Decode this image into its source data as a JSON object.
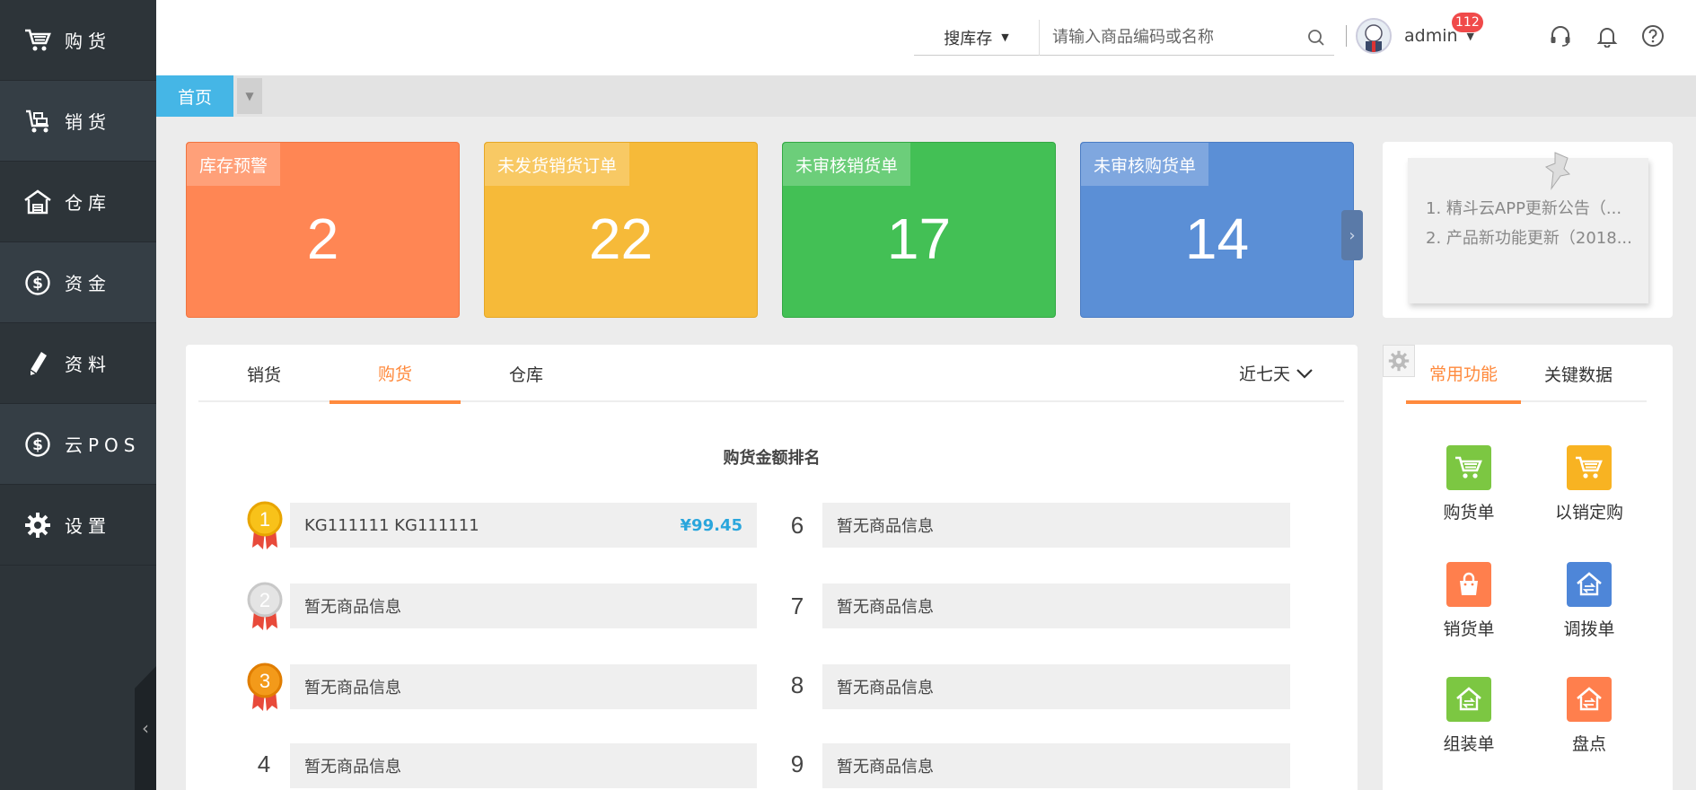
{
  "sidebar": {
    "items": [
      {
        "label": "购货",
        "icon": "cart-icon"
      },
      {
        "label": "销货",
        "icon": "trolley-icon"
      },
      {
        "label": "仓库",
        "icon": "warehouse-icon"
      },
      {
        "label": "资金",
        "icon": "dollar-icon"
      },
      {
        "label": "资料",
        "icon": "pencil-icon"
      },
      {
        "label": "云POS",
        "icon": "dollar-icon"
      },
      {
        "label": "设置",
        "icon": "gear-icon"
      }
    ],
    "collapse_glyph": "‹"
  },
  "header": {
    "search_type": "搜库存",
    "search_placeholder": "请输入商品编码或名称",
    "username": "admin",
    "notification_count": "112"
  },
  "tabs": {
    "home": "首页"
  },
  "stats": [
    {
      "label": "库存预警",
      "value": "2",
      "color": "#ff8654"
    },
    {
      "label": "未发货销货订单",
      "value": "22",
      "color": "#f6ba39"
    },
    {
      "label": "未审核销货单",
      "value": "17",
      "color": "#43c055"
    },
    {
      "label": "未审核购货单",
      "value": "14",
      "color": "#5b8fd6"
    }
  ],
  "notices": [
    "1. 精斗云APP更新公告（...",
    "2. 产品新功能更新（2018..."
  ],
  "main": {
    "tabs": [
      "销货",
      "购货",
      "仓库"
    ],
    "active_tab": "购货",
    "period": "近七天",
    "ranking_title": "购货金额排名",
    "ranking": [
      {
        "rank": "1",
        "name": "KG111111 KG111111",
        "amount": "¥99.45"
      },
      {
        "rank": "2",
        "name": "暂无商品信息",
        "amount": ""
      },
      {
        "rank": "3",
        "name": "暂无商品信息",
        "amount": ""
      },
      {
        "rank": "4",
        "name": "暂无商品信息",
        "amount": ""
      },
      {
        "rank": "6",
        "name": "暂无商品信息",
        "amount": ""
      },
      {
        "rank": "7",
        "name": "暂无商品信息",
        "amount": ""
      },
      {
        "rank": "8",
        "name": "暂无商品信息",
        "amount": ""
      },
      {
        "rank": "9",
        "name": "暂无商品信息",
        "amount": ""
      }
    ]
  },
  "functions": {
    "tabs": [
      "常用功能",
      "关键数据"
    ],
    "active_tab": "常用功能",
    "items": [
      {
        "label": "购货单",
        "icon": "cart-icon",
        "color": "#7cc742"
      },
      {
        "label": "以销定购",
        "icon": "cart-icon",
        "color": "#f8b322"
      },
      {
        "label": "销货单",
        "icon": "shopping-bag-icon",
        "color": "#ff7f4d"
      },
      {
        "label": "调拨单",
        "icon": "transfer-icon",
        "color": "#4e86d8"
      },
      {
        "label": "组装单",
        "icon": "assembly-icon",
        "color": "#7cc742"
      },
      {
        "label": "盘点",
        "icon": "inventory-icon",
        "color": "#ff7f4d"
      }
    ]
  }
}
